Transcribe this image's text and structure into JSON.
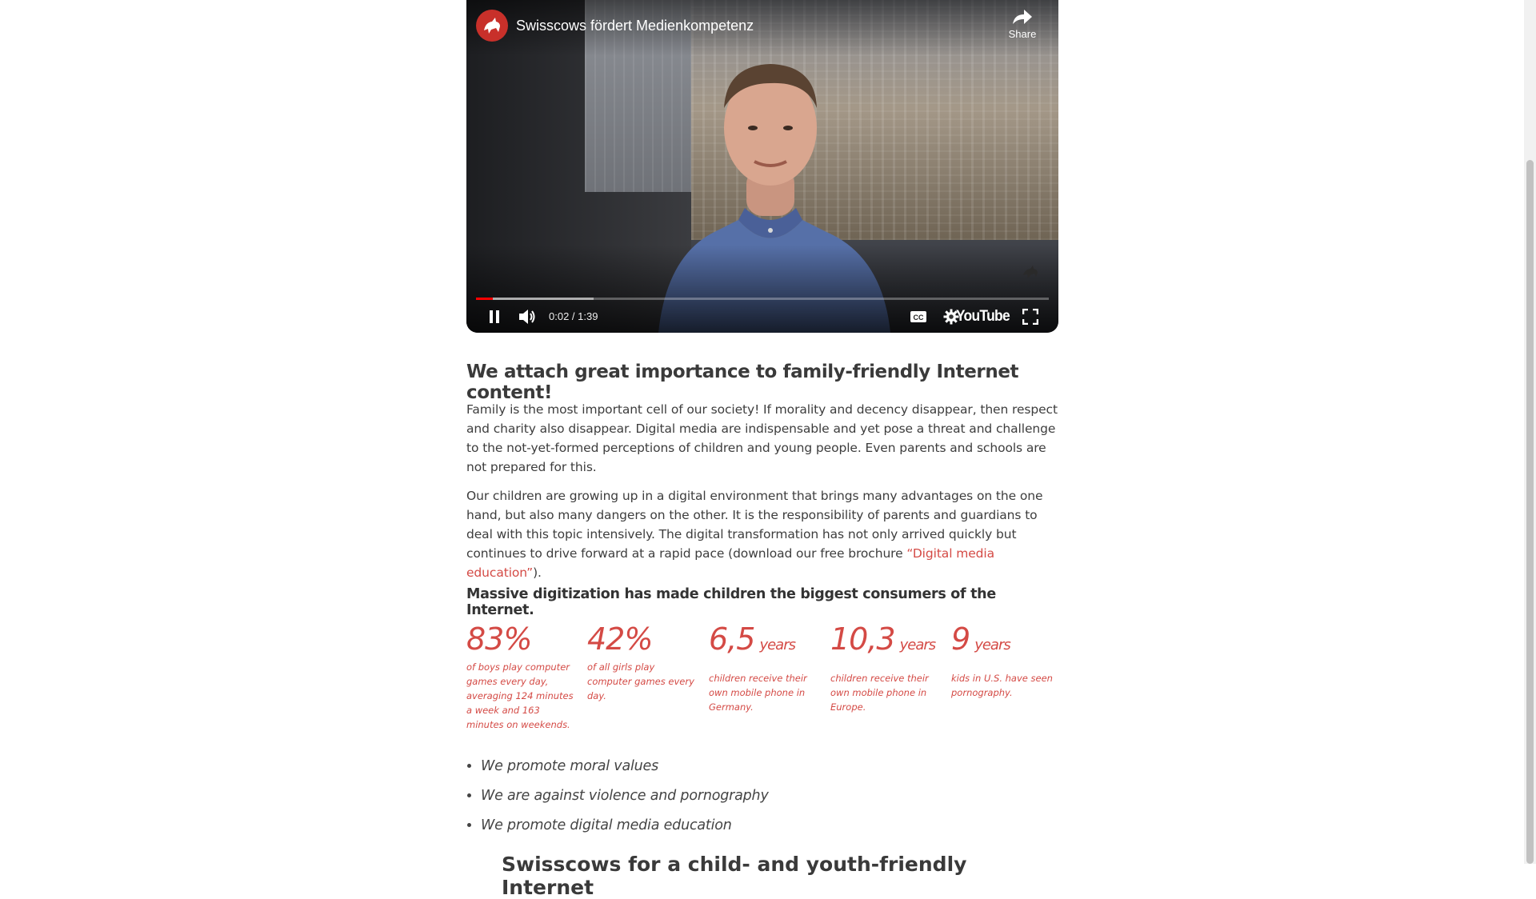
{
  "video": {
    "title": "Swisscows fördert Medienkompetenz",
    "share_label": "Share",
    "time_display": "0:02 / 1:39",
    "progress_played_fraction": 0.03,
    "progress_buffered_fraction": 0.205,
    "youtube_logo_text": "YouTube",
    "controls": {
      "pause_icon": "pause-icon",
      "volume_icon": "volume-icon",
      "cc_icon": "subtitles-icon",
      "settings_icon": "gear-icon",
      "fullscreen_icon": "fullscreen-icon"
    },
    "accent_color": "#ff0000"
  },
  "article": {
    "heading": "We attach great importance to family-friendly Internet content!",
    "paragraph1": "Family is the most important cell of our society! If morality and decency disappear, then respect and charity also disappear. Digital media are indispensable and yet pose a threat and challenge to the not-yet-formed perceptions of children and young people. Even parents and schools are not prepared for this.",
    "paragraph2_before": "Our children are growing up in a digital environment that brings many advantages on the one hand, but also many dangers on the other. It is the responsibility of parents and guardians to deal with this topic intensively. The digital transformation has not only arrived quickly but continues to drive forward at a rapid pace (download our free brochure ",
    "paragraph2_link": "“Digital media education”",
    "paragraph2_after": ").",
    "subheading": "Massive digitization has made children the biggest consumers of the Internet.",
    "stats": [
      {
        "value": "83%",
        "unit": "",
        "desc": "of boys play computer games every day, averaging 124 minutes a week and 163 minutes on weekends."
      },
      {
        "value": "42%",
        "unit": "",
        "desc": "of all girls play computer games every day."
      },
      {
        "value": "6,5",
        "unit": "years",
        "desc": "children receive their own mobile phone in Germany."
      },
      {
        "value": "10,3",
        "unit": "years",
        "desc": "children receive their own mobile phone in Europe."
      },
      {
        "value": "9",
        "unit": "years",
        "desc": "kids in U.S. have seen pornography."
      }
    ],
    "values_list": [
      "We promote moral values",
      "We are against violence and pornography",
      "We promote digital media education"
    ],
    "next_heading_partial": "Swisscows for a child- and youth-friendly Internet",
    "accent_color": "#d44a45"
  }
}
